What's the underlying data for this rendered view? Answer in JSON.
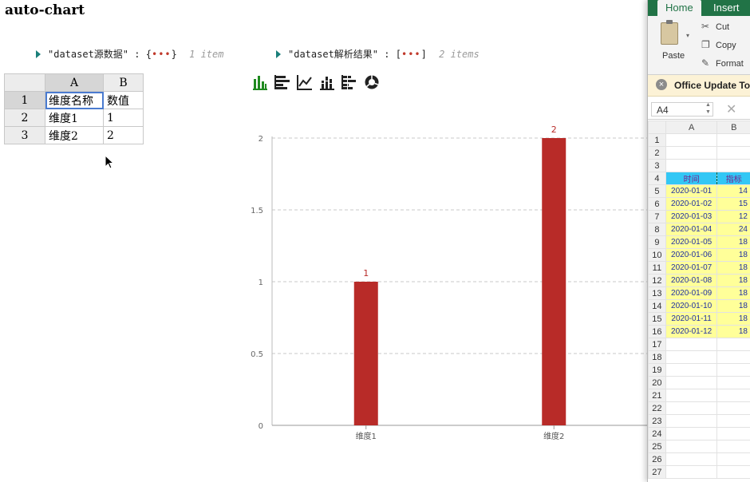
{
  "app_title": "auto-chart",
  "json_viewer": {
    "source": {
      "key": "\"dataset源数据\"",
      "colon": ":",
      "open": "{",
      "dots": "•••",
      "close": "}",
      "count": "1 item"
    },
    "result": {
      "key": "\"dataset解析结果\"",
      "colon": ":",
      "open": "[",
      "dots": "•••",
      "close": "]",
      "count": "2 items"
    }
  },
  "spreadsheet": {
    "columns": [
      "A",
      "B"
    ],
    "rows": [
      {
        "num": "1",
        "a": "维度名称",
        "b": "数值"
      },
      {
        "num": "2",
        "a": "维度1",
        "b": "1"
      },
      {
        "num": "3",
        "a": "维度2",
        "b": "2"
      }
    ]
  },
  "chart_toolbar": [
    "bar-chart-icon",
    "horizontal-bar-chart-icon",
    "line-chart-icon",
    "stacked-bar-chart-icon",
    "stacked-horizontal-bar-chart-icon",
    "pie-chart-icon"
  ],
  "colors": {
    "bar": "#b82b28",
    "accent": "#217346",
    "toolbar_active": "#1f8a1f"
  },
  "chart_data": {
    "type": "bar",
    "categories": [
      "维度1",
      "维度2"
    ],
    "values": [
      1,
      2
    ],
    "data_labels": [
      "1",
      "2"
    ],
    "ylim": [
      0,
      2
    ],
    "yticks": [
      "0",
      "0.5",
      "1",
      "1.5",
      "2"
    ],
    "title": "",
    "xlabel": "",
    "ylabel": "",
    "grid": "dashed horizontal"
  },
  "excel": {
    "tabs": {
      "home": "Home",
      "insert": "Insert"
    },
    "ribbon": {
      "paste": "Paste",
      "cut": "Cut",
      "copy": "Copy",
      "format": "Format"
    },
    "notice": "Office Update  To",
    "name_box": "A4",
    "col_a": "A",
    "col_b": "B",
    "header_row": {
      "a": "时间",
      "b": "指标"
    },
    "data": [
      {
        "date": "2020-01-01",
        "val": "14"
      },
      {
        "date": "2020-01-02",
        "val": "15"
      },
      {
        "date": "2020-01-03",
        "val": "12"
      },
      {
        "date": "2020-01-04",
        "val": "24"
      },
      {
        "date": "2020-01-05",
        "val": "18"
      },
      {
        "date": "2020-01-06",
        "val": "18"
      },
      {
        "date": "2020-01-07",
        "val": "18"
      },
      {
        "date": "2020-01-08",
        "val": "18"
      },
      {
        "date": "2020-01-09",
        "val": "18"
      },
      {
        "date": "2020-01-10",
        "val": "18"
      },
      {
        "date": "2020-01-11",
        "val": "18"
      },
      {
        "date": "2020-01-12",
        "val": "18"
      }
    ],
    "row_numbers": [
      "1",
      "2",
      "3",
      "4",
      "5",
      "6",
      "7",
      "8",
      "9",
      "10",
      "11",
      "12",
      "13",
      "14",
      "15",
      "16",
      "17",
      "18",
      "19",
      "20",
      "21",
      "22",
      "23",
      "24",
      "25",
      "26",
      "27"
    ]
  }
}
